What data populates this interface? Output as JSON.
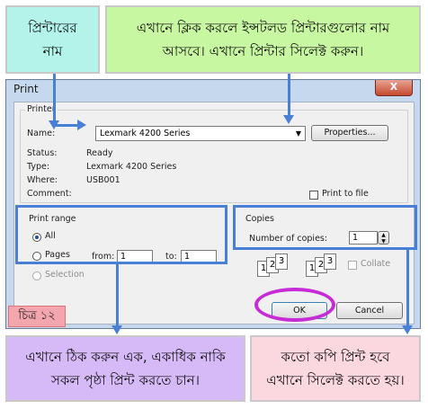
{
  "callouts": {
    "printer_name": [
      "প্রিন্টারের",
      "নাম"
    ],
    "select_printer": [
      "এখানে ক্লিক করলে ইন্সটলড প্রিন্টারগুলোর নাম",
      "আসবে। এখানে প্রিন্টার সিলেক্ট করুন।"
    ],
    "print_range": [
      "এখানে ঠিক করুন এক, একাধিক নাকি",
      "সকল পৃষ্ঠা প্রিন্ট করতে চান।"
    ],
    "copies": [
      "কতো কপি প্রিন্ট হবে",
      "এখানে সিলেক্ট করতে হয়।"
    ]
  },
  "figure_label": "চিত্র ১২",
  "dialog": {
    "title": "Print",
    "close": "X",
    "printer": {
      "group_label": "Printer",
      "name_label": "Name:",
      "name_value": "Lexmark 4200 Series",
      "properties_button": "Properties...",
      "status_label": "Status:",
      "status_value": "Ready",
      "type_label": "Type:",
      "type_value": "Lexmark 4200 Series",
      "where_label": "Where:",
      "where_value": "USB001",
      "comment_label": "Comment:",
      "print_to_file": "Print to file"
    },
    "range": {
      "group_label": "Print range",
      "all": "All",
      "pages": "Pages",
      "from_label": "from:",
      "from_value": "1",
      "to_label": "to:",
      "to_value": "1",
      "selection": "Selection"
    },
    "copies": {
      "group_label": "Copies",
      "number_label": "Number of copies:",
      "number_value": "1",
      "collate": "Collate",
      "collate_pages": [
        "1",
        "2",
        "3"
      ]
    },
    "ok_button": "OK",
    "cancel_button": "Cancel"
  },
  "colors": {
    "highlight": "#4a7fd6",
    "ok_circle": "#c62bd6",
    "callout_cyan": "#b3f3ea",
    "callout_green": "#c8f7a2",
    "callout_purple": "#d6b9f7",
    "callout_pink": "#fbd7e0",
    "figure_label_bg": "#f3a6ad"
  }
}
